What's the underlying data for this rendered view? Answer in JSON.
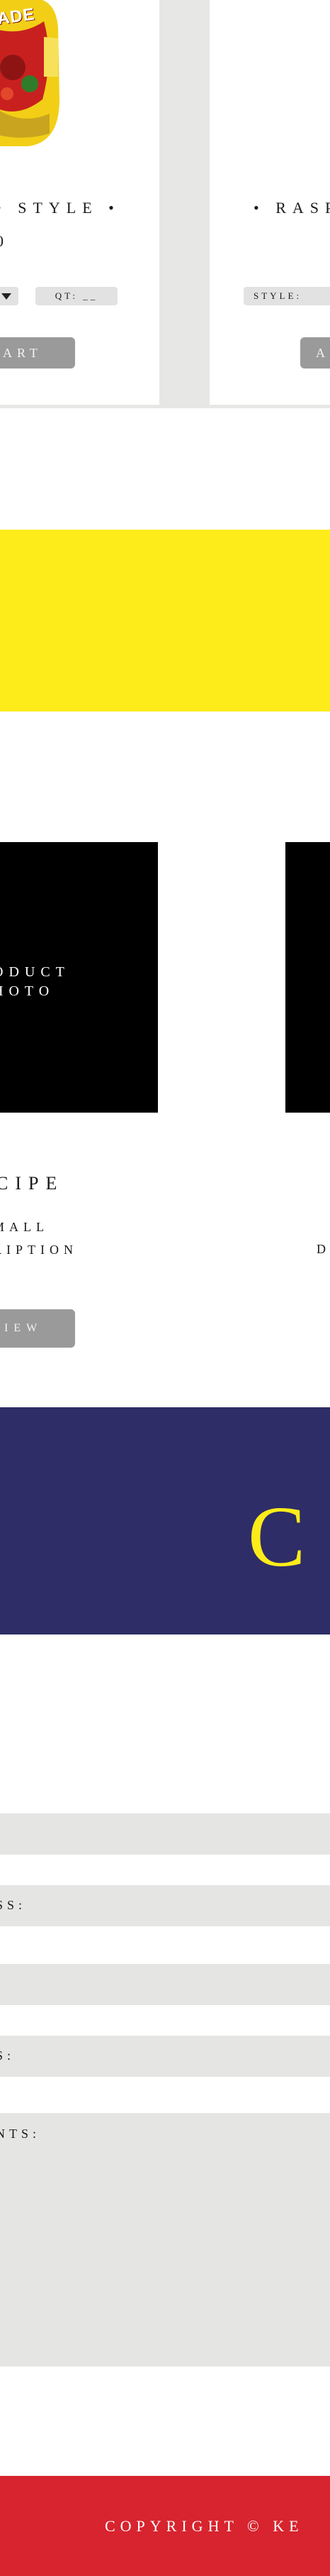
{
  "products": [
    {
      "title": "• STYLE •",
      "price": "0",
      "style_label": "",
      "qty_label": "QT: __",
      "cart_label": "ART",
      "jar_label": "ADE"
    },
    {
      "title": "• RASP",
      "style_label": "STYLE:",
      "cart_label": "A"
    }
  ],
  "recipes": [
    {
      "photo_label": "ODUCT\nHOTO",
      "title": "CIPE",
      "description": "MALL\nRIPTION",
      "view_label": "IEW"
    },
    {
      "description": "D"
    }
  ],
  "contact": {
    "heading": "C"
  },
  "form": {
    "field_2_label": "SS:",
    "field_4_label": "S:",
    "field_5_label": "NTS:"
  },
  "footer": {
    "copyright": "COPYRIGHT © KE"
  },
  "colors": {
    "yellow": "#fdec1a",
    "navy": "#2e2d67",
    "red": "#d7242e",
    "gray_button": "#9a9a9a",
    "light_gray": "#e7e7e5"
  }
}
